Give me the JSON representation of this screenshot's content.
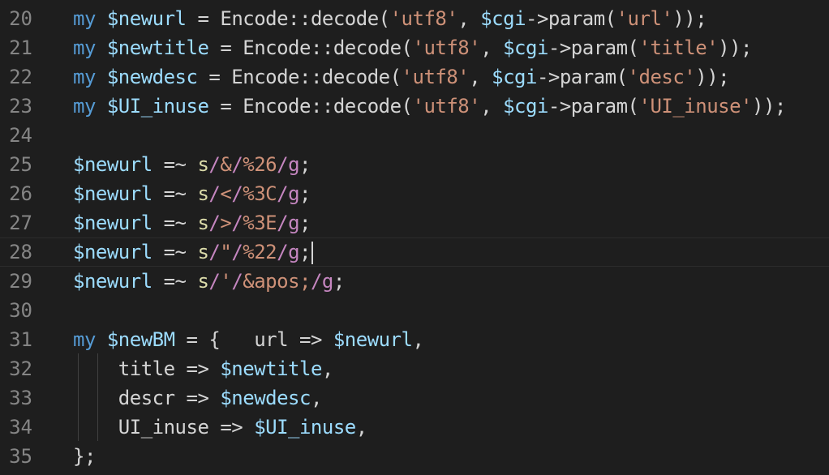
{
  "editor": {
    "lines": [
      {
        "num": "20",
        "tokens": [
          [
            "kw",
            "my "
          ],
          [
            "var",
            "$newurl"
          ],
          [
            "op",
            " = Encode::decode("
          ],
          [
            "str",
            "'utf8'"
          ],
          [
            "op",
            ", "
          ],
          [
            "var",
            "$cgi"
          ],
          [
            "op",
            "->param("
          ],
          [
            "str",
            "'url'"
          ],
          [
            "op",
            "));"
          ]
        ]
      },
      {
        "num": "21",
        "tokens": [
          [
            "kw",
            "my "
          ],
          [
            "var",
            "$newtitle"
          ],
          [
            "op",
            " = Encode::decode("
          ],
          [
            "str",
            "'utf8'"
          ],
          [
            "op",
            ", "
          ],
          [
            "var",
            "$cgi"
          ],
          [
            "op",
            "->param("
          ],
          [
            "str",
            "'title'"
          ],
          [
            "op",
            "));"
          ]
        ]
      },
      {
        "num": "22",
        "tokens": [
          [
            "kw",
            "my "
          ],
          [
            "var",
            "$newdesc"
          ],
          [
            "op",
            " = Encode::decode("
          ],
          [
            "str",
            "'utf8'"
          ],
          [
            "op",
            ", "
          ],
          [
            "var",
            "$cgi"
          ],
          [
            "op",
            "->param("
          ],
          [
            "str",
            "'desc'"
          ],
          [
            "op",
            "));"
          ]
        ]
      },
      {
        "num": "23",
        "tokens": [
          [
            "kw",
            "my "
          ],
          [
            "var",
            "$UI_inuse"
          ],
          [
            "op",
            " = Encode::decode("
          ],
          [
            "str",
            "'utf8'"
          ],
          [
            "op",
            ", "
          ],
          [
            "var",
            "$cgi"
          ],
          [
            "op",
            "->param("
          ],
          [
            "str",
            "'UI_inuse'"
          ],
          [
            "op",
            "));"
          ]
        ]
      },
      {
        "num": "24",
        "tokens": []
      },
      {
        "num": "25",
        "tokens": [
          [
            "var",
            "$newurl"
          ],
          [
            "op",
            " =~ "
          ],
          [
            "rx",
            "s"
          ],
          [
            "rxd",
            "/"
          ],
          [
            "str",
            "&"
          ],
          [
            "rxd",
            "/"
          ],
          [
            "str",
            "%26"
          ],
          [
            "rxd",
            "/"
          ],
          [
            "rxd",
            "g"
          ],
          [
            "op",
            ";"
          ]
        ]
      },
      {
        "num": "26",
        "tokens": [
          [
            "var",
            "$newurl"
          ],
          [
            "op",
            " =~ "
          ],
          [
            "rx",
            "s"
          ],
          [
            "rxd",
            "/"
          ],
          [
            "str",
            "<"
          ],
          [
            "rxd",
            "/"
          ],
          [
            "str",
            "%3C"
          ],
          [
            "rxd",
            "/"
          ],
          [
            "rxd",
            "g"
          ],
          [
            "op",
            ";"
          ]
        ]
      },
      {
        "num": "27",
        "tokens": [
          [
            "var",
            "$newurl"
          ],
          [
            "op",
            " =~ "
          ],
          [
            "rx",
            "s"
          ],
          [
            "rxd",
            "/"
          ],
          [
            "str",
            ">"
          ],
          [
            "rxd",
            "/"
          ],
          [
            "str",
            "%3E"
          ],
          [
            "rxd",
            "/"
          ],
          [
            "rxd",
            "g"
          ],
          [
            "op",
            ";"
          ]
        ]
      },
      {
        "num": "28",
        "tokens": [
          [
            "var",
            "$newurl"
          ],
          [
            "op",
            " =~ "
          ],
          [
            "rx",
            "s"
          ],
          [
            "rxd",
            "/"
          ],
          [
            "str",
            "\""
          ],
          [
            "rxd",
            "/"
          ],
          [
            "str",
            "%22"
          ],
          [
            "rxd",
            "/"
          ],
          [
            "rxd",
            "g"
          ],
          [
            "op",
            ";"
          ]
        ],
        "current": true
      },
      {
        "num": "29",
        "tokens": [
          [
            "var",
            "$newurl"
          ],
          [
            "op",
            " =~ "
          ],
          [
            "rx",
            "s"
          ],
          [
            "rxd",
            "/"
          ],
          [
            "str",
            "'"
          ],
          [
            "rxd",
            "/"
          ],
          [
            "str",
            "&apos;"
          ],
          [
            "rxd",
            "/"
          ],
          [
            "rxd",
            "g"
          ],
          [
            "op",
            ";"
          ]
        ]
      },
      {
        "num": "30",
        "tokens": []
      },
      {
        "num": "31",
        "tokens": [
          [
            "kw",
            "my "
          ],
          [
            "var",
            "$newBM"
          ],
          [
            "op",
            " = {   url => "
          ],
          [
            "var",
            "$newurl"
          ],
          [
            "op",
            ","
          ]
        ]
      },
      {
        "num": "32",
        "tokens": [
          [
            "op",
            "    title => "
          ],
          [
            "var",
            "$newtitle"
          ],
          [
            "op",
            ","
          ]
        ]
      },
      {
        "num": "33",
        "tokens": [
          [
            "op",
            "    descr => "
          ],
          [
            "var",
            "$newdesc"
          ],
          [
            "op",
            ","
          ]
        ]
      },
      {
        "num": "34",
        "tokens": [
          [
            "op",
            "    UI_inuse => "
          ],
          [
            "var",
            "$UI_inuse"
          ],
          [
            "op",
            ","
          ]
        ]
      },
      {
        "num": "35",
        "tokens": [
          [
            "op",
            "};"
          ]
        ]
      }
    ]
  },
  "colors": {
    "background": "#1e1e1e",
    "keyword": "#569cd6",
    "variable": "#9cdcfe",
    "string": "#ce9178",
    "operator": "#d4d4d4",
    "line_number": "#858585"
  }
}
